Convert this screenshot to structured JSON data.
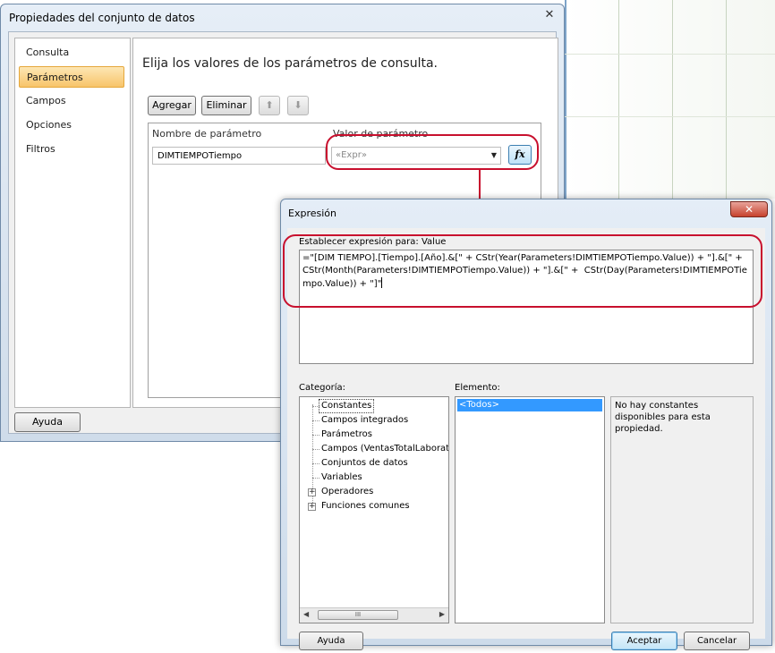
{
  "dataset_dialog": {
    "title": "Propiedades del conjunto de datos",
    "close_glyph": "✕",
    "nav": [
      {
        "label": "Consulta",
        "active": false
      },
      {
        "label": "Parámetros",
        "active": true
      },
      {
        "label": "Campos",
        "active": false
      },
      {
        "label": "Opciones",
        "active": false
      },
      {
        "label": "Filtros",
        "active": false
      }
    ],
    "heading": "Elija los valores de los parámetros de consulta.",
    "toolbar": {
      "add_label": "Agregar",
      "delete_label": "Eliminar",
      "up_glyph": "⬆",
      "down_glyph": "⬇"
    },
    "grid": {
      "col_name": "Nombre de parámetro",
      "col_value": "Valor de parámetro",
      "row": {
        "name": "DIMTIEMPOTiempo",
        "value": "«Expr»",
        "dropdown_glyph": "▼",
        "fx_label": "fx"
      }
    },
    "help_label": "Ayuda"
  },
  "expression_dialog": {
    "title": "Expresión",
    "close_glyph": "✕",
    "set_expression_label": "Establecer expresión para: Value",
    "expression": "=\"[DIM TIEMPO].[Tiempo].[Año].&[\" + CStr(Year(Parameters!DIMTIEMPOTiempo.Value)) + \"].&[\" + CStr(Month(Parameters!DIMTIEMPOTiempo.Value)) + \"].&[\" +  CStr(Day(Parameters!DIMTIEMPOTiempo.Value)) + \"]\"",
    "category_label": "Categoría:",
    "element_label": "Elemento:",
    "categories": [
      {
        "label": "Constantes",
        "expandable": false,
        "selected": true
      },
      {
        "label": "Campos integrados",
        "expandable": false,
        "selected": false
      },
      {
        "label": "Parámetros",
        "expandable": false,
        "selected": false
      },
      {
        "label": "Campos (VentasTotalLaboratorio)",
        "expandable": false,
        "selected": false
      },
      {
        "label": "Conjuntos de datos",
        "expandable": false,
        "selected": false
      },
      {
        "label": "Variables",
        "expandable": false,
        "selected": false
      },
      {
        "label": "Operadores",
        "expandable": true,
        "selected": false
      },
      {
        "label": "Funciones comunes",
        "expandable": true,
        "selected": false
      }
    ],
    "expander_glyph": "+",
    "scroll_left_glyph": "◀",
    "scroll_right_glyph": "▶",
    "scroll_thumb_glyph": "III",
    "element_selected": "<Todos>",
    "description": "No hay constantes disponibles para esta propiedad.",
    "help_label": "Ayuda",
    "accept_label": "Aceptar",
    "cancel_label": "Cancelar"
  },
  "colors": {
    "highlight_red": "#c8102e",
    "selection_blue": "#3399ff",
    "nav_active": "#f8c46a"
  }
}
